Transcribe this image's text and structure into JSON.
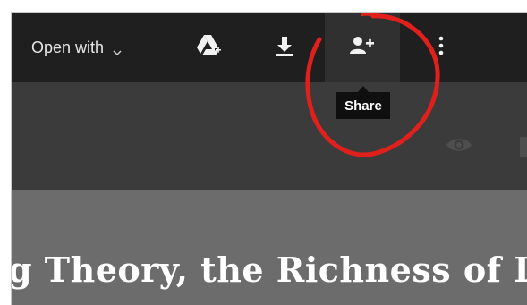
{
  "toolbar": {
    "open_with_label": "Open with"
  },
  "tooltip": {
    "share_label": "Share"
  },
  "document": {
    "title_visible": "g Theory, the Richness of L"
  },
  "icons": {
    "open_with_chevron": "chevron-down-icon",
    "drive": "add-to-drive-icon",
    "download": "download-icon",
    "share": "add-person-icon",
    "more": "more-vert-icon",
    "preview": "eye-icon"
  },
  "colors": {
    "annotation_circle": "#e0201c"
  }
}
